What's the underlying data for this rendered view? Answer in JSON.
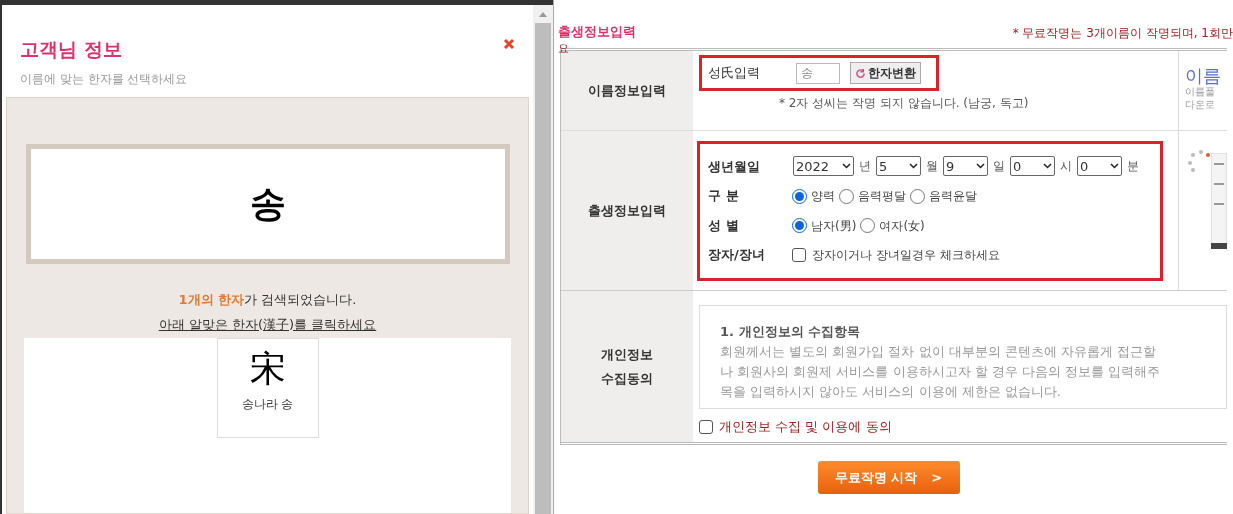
{
  "popup": {
    "title": "고객님 정보",
    "subtitle": "이름에 맞는 한자를 선택하세요",
    "searched_name": "송",
    "result_text": "**1개의 한자**가 검색되었습니다.",
    "instruction": "아래 알맞은 한자(漢子)를 클릭하세요",
    "hanja": [
      {
        "character": "宋",
        "meaning": "송나라 송"
      }
    ]
  },
  "form": {
    "heading": "출생정보입력",
    "stray_text": "요",
    "notice": "* 무료작명는 3개이름이 작명되며, 1회만",
    "name_row": {
      "label": "이름정보입력",
      "field_label": "성氏입력",
      "surname": "송",
      "convert_button": "한자변환",
      "note": "* 2자 성씨는 작명 되지 않습니다. (남궁, 독고)"
    },
    "birth_row": {
      "label": "출생정보입력",
      "date_label": "생년월일",
      "date_parts": [
        {
          "value": "2022",
          "unit": "년"
        },
        {
          "value": "5",
          "unit": "월"
        },
        {
          "value": "9",
          "unit": "일"
        },
        {
          "value": "0",
          "unit": "시"
        },
        {
          "value": "0",
          "unit": "분"
        }
      ],
      "calendar": {
        "label": "구 분",
        "options": [
          {
            "label": "양력",
            "selected": true
          },
          {
            "label": "음력평달",
            "selected": false
          },
          {
            "label": "음력윤달",
            "selected": false
          }
        ]
      },
      "gender": {
        "label": "성 별",
        "options": [
          {
            "label": "남자(男)",
            "selected": true
          },
          {
            "label": "여자(女)",
            "selected": false
          }
        ]
      },
      "eldest": {
        "label": "장자/장녀",
        "text": "장자이거나 장녀일경우 체크하세요",
        "checked": false
      }
    },
    "privacy_row": {
      "label_lines": [
        "개인정보",
        "수집동의"
      ],
      "box_heading": "1. 개인정보의 수집항목",
      "box_lines": [
        "회원께서는 별도의 회원가입 절차 없이 대부분의 콘텐츠에 자유롭게 접근할",
        "나 회원사의 회원제 서비스를 이용하시고자 할 경우 다음의 정보를 입력해주",
        "목을 입력하시지 않아도 서비스의 이용에 제한은 없습니다."
      ],
      "consent": {
        "text": "개인정보 수집 및 이용에 동의",
        "checked": false
      }
    },
    "side_panel": {
      "title": "이름",
      "lines": [
        "이름풀",
        "다운로"
      ]
    },
    "submit_button": {
      "label": "무료작명 시작",
      "arrow": ">"
    }
  }
}
